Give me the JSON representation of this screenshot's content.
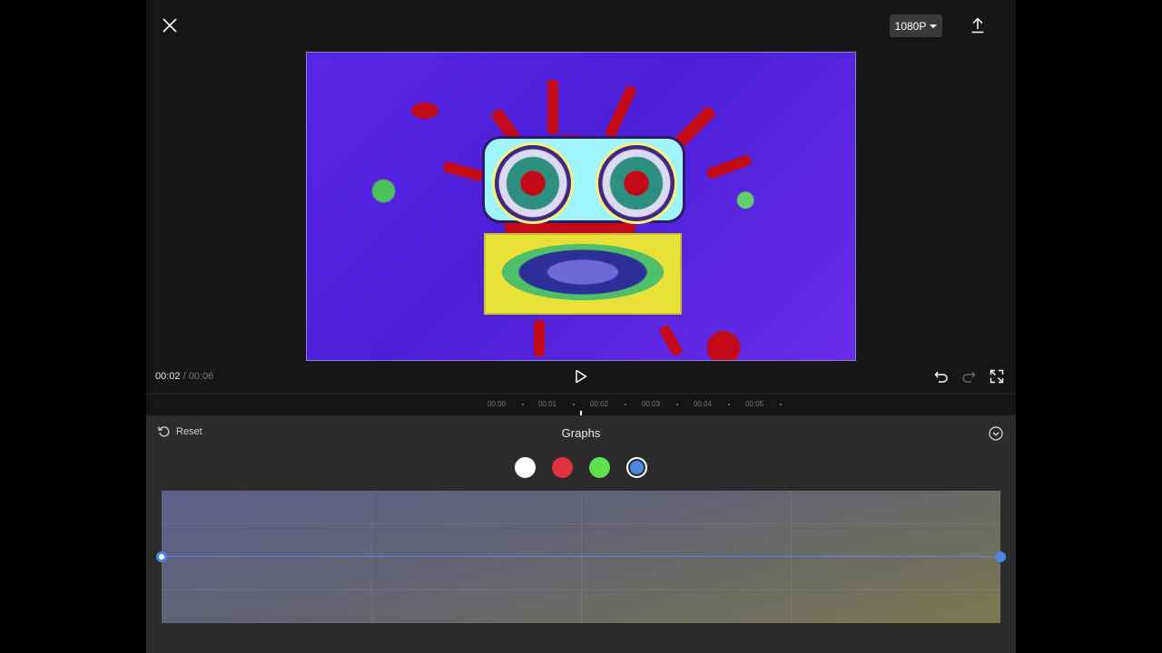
{
  "topbar": {
    "close_icon": "close-icon",
    "resolution": "1080P",
    "export_icon": "upload-icon"
  },
  "player": {
    "current_time": "00:02",
    "separator": "/",
    "total_time": "00:06"
  },
  "timeline": {
    "ticks": [
      "00:00",
      "00:01",
      "00:02",
      "00:03",
      "00:04",
      "00:05"
    ]
  },
  "panel": {
    "reset_label": "Reset",
    "title": "Graphs",
    "channels": [
      {
        "name": "white",
        "color": "#ffffff",
        "selected": false
      },
      {
        "name": "red",
        "color": "#e0313f",
        "selected": false
      },
      {
        "name": "green",
        "color": "#5fe04f",
        "selected": false
      },
      {
        "name": "blue",
        "color": "#4f86e0",
        "selected": true
      }
    ],
    "accent_color": "#4f86e0"
  }
}
